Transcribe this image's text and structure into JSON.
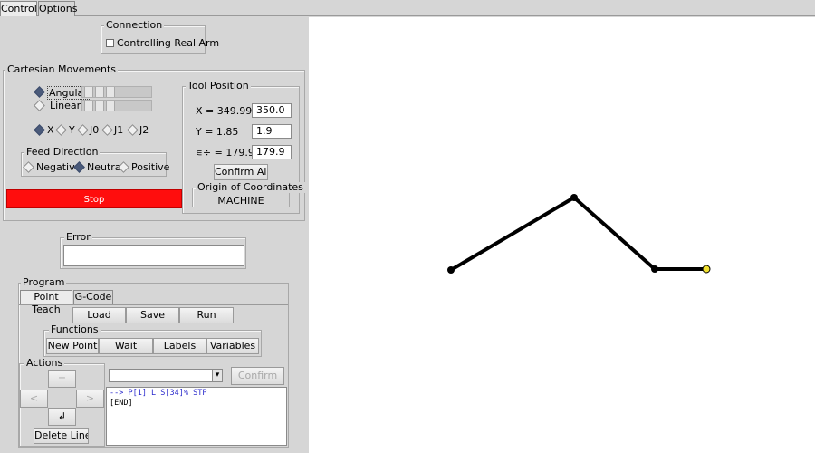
{
  "tabs": [
    "Control",
    "Options"
  ],
  "connection": {
    "title": "Connection",
    "checkbox_label": "Controlling Real Arm",
    "checked": false
  },
  "cartesian": {
    "title": "Cartesian Movements",
    "angular_label": "Angular",
    "linear_label": "Linear",
    "mode_selected": "Angular",
    "axes": [
      "X",
      "Y",
      "J0",
      "J1",
      "J2"
    ],
    "axis_selected": "X",
    "feed": {
      "title": "Feed Direction",
      "options": [
        "Negative",
        "Neutral",
        "Positive"
      ],
      "selected": "Neutral"
    },
    "stop_label": "Stop",
    "stop_color": "#ff0d0d"
  },
  "tool_position": {
    "title": "Tool Position",
    "x_label": "X = 349.99",
    "x_value": "350.0",
    "y_label": "Y = 1.85",
    "y_value": "1.9",
    "a_label": "∊÷ = 179.93°",
    "a_value": "179.9",
    "confirm_label": "Confirm All",
    "origin_title": "Origin of Coordinates",
    "origin_value": "MACHINE"
  },
  "error": {
    "title": "Error",
    "text": ""
  },
  "program": {
    "title": "Program",
    "tabs": [
      "Point Teach",
      "G-Code"
    ],
    "buttons": [
      "Load",
      "Save",
      "Run"
    ],
    "functions_title": "Functions",
    "functions": [
      "New Point",
      "Wait",
      "Labels",
      "Variables"
    ],
    "actions_title": "Actions",
    "actions": {
      "up": "±",
      "left": "<",
      "right": ">",
      "insert": "↲",
      "delete": "Delete Line"
    },
    "combo_value": "",
    "combo_arrow": "▾",
    "confirm_label": "Confirm",
    "code_lines": [
      "--> P[1] L S[34]% STP",
      "[END]"
    ],
    "code_colors": [
      "#2a2acc",
      "#000000"
    ]
  },
  "visualization": {
    "arm_color": "#000000",
    "tool_color": "#f0e030",
    "joints": [
      [
        498,
        298
      ],
      [
        634,
        218
      ],
      [
        723,
        297
      ],
      [
        780,
        297
      ]
    ]
  }
}
